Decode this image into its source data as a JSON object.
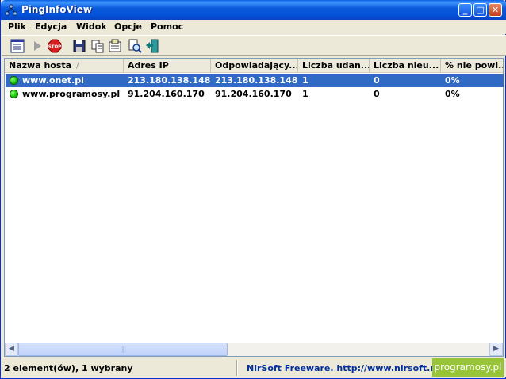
{
  "window": {
    "title": "PingInfoView",
    "app_icon": "network-nodes-icon",
    "controls": {
      "minimize": "minimize-icon",
      "maximize": "maximize-icon",
      "close": "close-icon"
    }
  },
  "menu": [
    "Plik",
    "Edycja",
    "Widok",
    "Opcje",
    "Pomoc"
  ],
  "toolbar": [
    {
      "name": "properties-list-icon"
    },
    {
      "name": "start-icon"
    },
    {
      "name": "stop-icon",
      "label": "STOP"
    },
    {
      "name": "save-icon"
    },
    {
      "name": "copy-icon"
    },
    {
      "name": "properties-icon"
    },
    {
      "name": "find-icon"
    },
    {
      "name": "exit-icon"
    }
  ],
  "table": {
    "columns": [
      "Nazwa hosta",
      "Adres IP",
      "Odpowiadający...",
      "Liczba udan...",
      "Liczba nieu...",
      "% nie powi..."
    ],
    "sort_indicator": "/",
    "rows": [
      {
        "host": "www.onet.pl",
        "ip": "213.180.138.148",
        "replying": "213.180.138.148",
        "succeeded": "1",
        "failed": "0",
        "failed_pct": "0%",
        "selected": true
      },
      {
        "host": "www.programosy.pl",
        "ip": "91.204.160.170",
        "replying": "91.204.160.170",
        "succeeded": "1",
        "failed": "0",
        "failed_pct": "0%",
        "selected": false
      }
    ]
  },
  "status": {
    "items_text": "2 element(ów), 1 wybrany",
    "nirsoft_text": "NirSoft Freeware.  http://www.nirsoft.net",
    "badge_text": "programosy.pl",
    "badge_color": "#98c43a"
  },
  "colors": {
    "selection": "#316ac5",
    "status_ok": "#12c000",
    "titlebar": "#0352d8"
  }
}
